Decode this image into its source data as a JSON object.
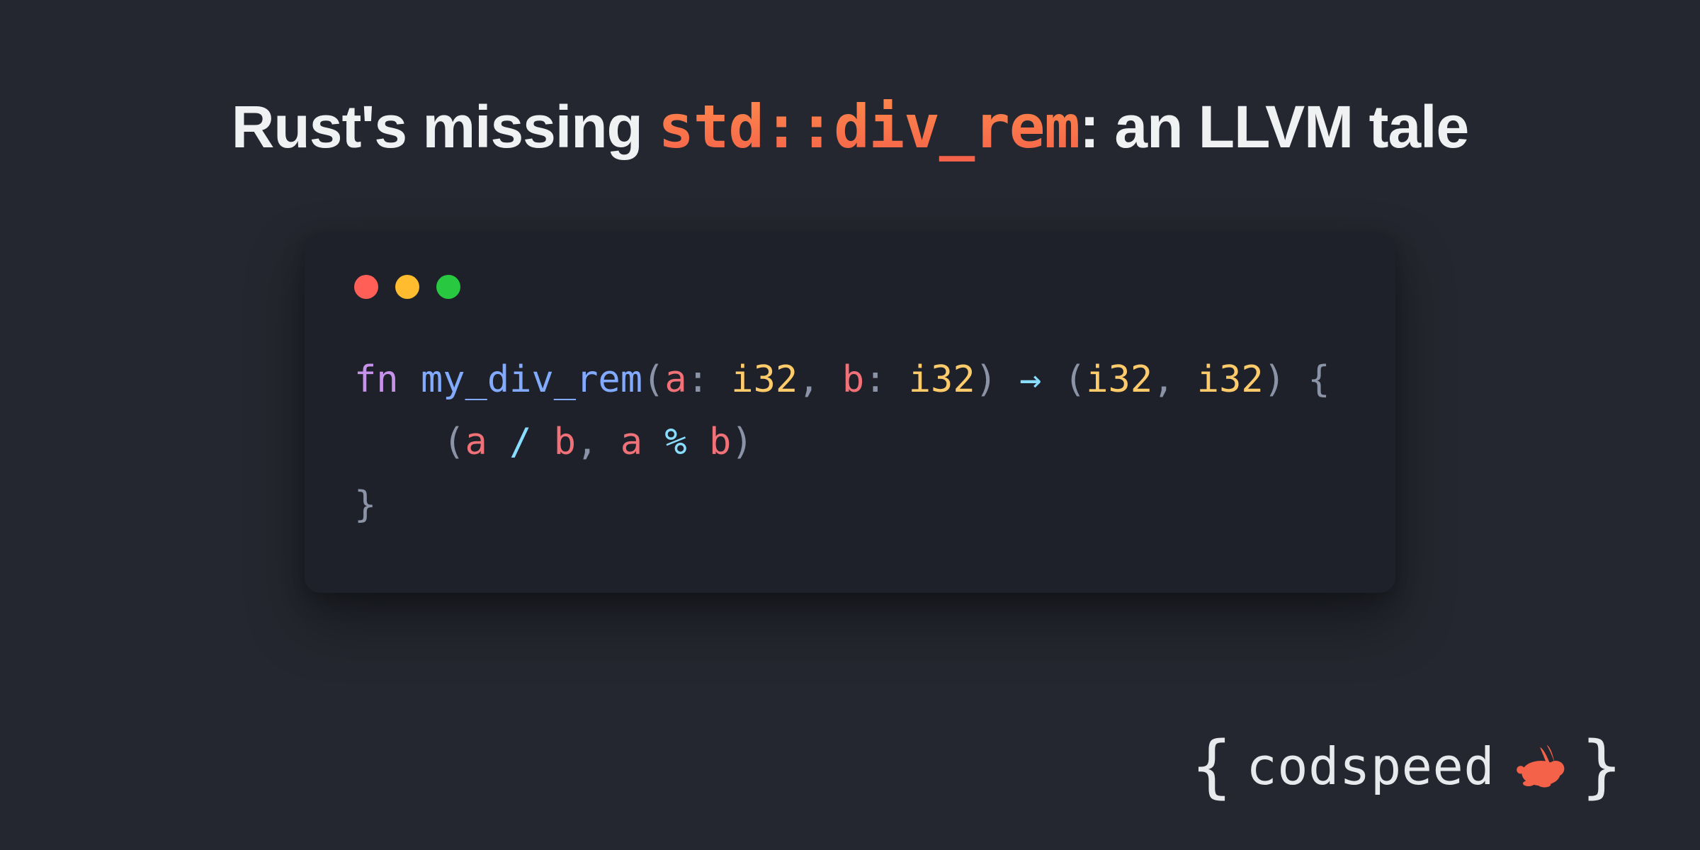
{
  "title": {
    "pre": "Rust's missing ",
    "code": "std::div_rem",
    "post": ": an LLVM tale"
  },
  "traffic_colors": {
    "red": "#ff5f57",
    "yellow": "#febc2e",
    "green": "#28c840"
  },
  "code": {
    "line1": {
      "kw": "fn",
      "sp1": " ",
      "fn": "my_div_rem",
      "lparen": "(",
      "p1": "a",
      "colon1": ": ",
      "t1": "i32",
      "comma1": ", ",
      "p2": "b",
      "colon2": ": ",
      "t2": "i32",
      "rparen": ")",
      "sp2": " ",
      "arrow": "→",
      "sp3": " ",
      "tlparen": "(",
      "rt1": "i32",
      "tcomma": ", ",
      "rt2": "i32",
      "trparen": ")",
      "sp4": " ",
      "lbrace": "{"
    },
    "line2": {
      "indent": "    ",
      "lparen": "(",
      "a1": "a",
      "sp1": " ",
      "op1": "/",
      "sp2": " ",
      "b1": "b",
      "comma": ", ",
      "a2": "a",
      "sp3": " ",
      "op2": "%",
      "sp4": " ",
      "b2": "b",
      "rparen": ")"
    },
    "line3": {
      "rbrace": "}"
    }
  },
  "brand": {
    "lbrace": "{",
    "name": "codspeed",
    "rbrace": "}",
    "icon_color": "#f4624a"
  }
}
